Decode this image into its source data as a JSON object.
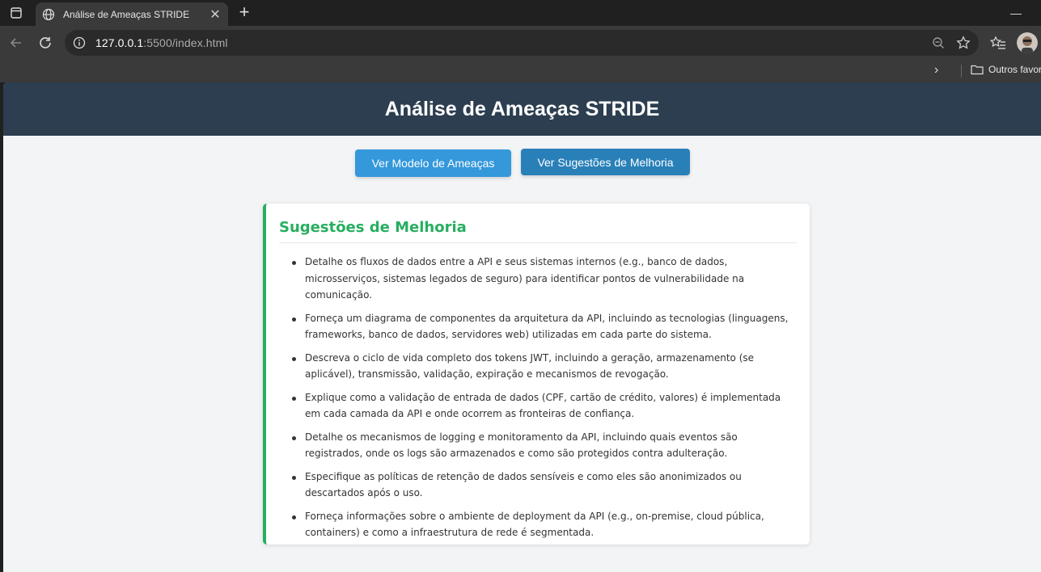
{
  "browser": {
    "tab_title": "Análise de Ameaças STRIDE",
    "url_host": "127.0.0.1",
    "url_rest": ":5500/index.html",
    "bookmark_folder": "Outros favor"
  },
  "page": {
    "title": "Análise de Ameaças STRIDE",
    "buttons": {
      "threat_model": "Ver Modelo de Ameaças",
      "suggestions": "Ver Sugestões de Melhoria"
    },
    "card": {
      "heading": "Sugestões de Melhoria",
      "items": [
        "Detalhe os fluxos de dados entre a API e seus sistemas internos (e.g., banco de dados, microsserviços, sistemas legados de seguro) para identificar pontos de vulnerabilidade na comunicação.",
        "Forneça um diagrama de componentes da arquitetura da API, incluindo as tecnologias (linguagens, frameworks, banco de dados, servidores web) utilizadas em cada parte do sistema.",
        "Descreva o ciclo de vida completo dos tokens JWT, incluindo a geração, armazenamento (se aplicável), transmissão, validação, expiração e mecanismos de revogação.",
        "Explique como a validação de entrada de dados (CPF, cartão de crédito, valores) é implementada em cada camada da API e onde ocorrem as fronteiras de confiança.",
        "Detalhe os mecanismos de logging e monitoramento da API, incluindo quais eventos são registrados, onde os logs são armazenados e como são protegidos contra adulteração.",
        "Especifique as políticas de retenção de dados sensíveis e como eles são anonimizados ou descartados após o uso.",
        "Forneça informações sobre o ambiente de deployment da API (e.g., on-premise, cloud pública, containers) e como a infraestrutura de rede é segmentada."
      ]
    }
  },
  "colors": {
    "header_bg": "#2c3e50",
    "button_primary": "#3498db",
    "button_active": "#2980b9",
    "accent_green": "#27ae60",
    "page_bg": "#f3f4f6"
  }
}
